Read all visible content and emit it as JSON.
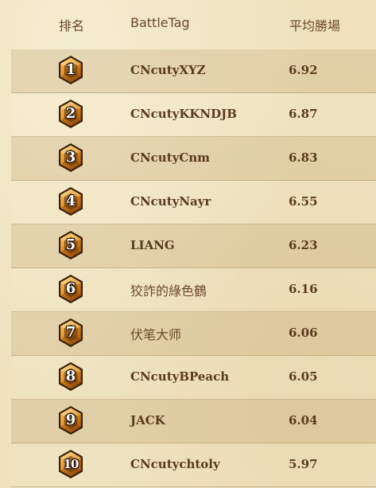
{
  "header": {
    "rank_label": "排名",
    "battletag_label": "BattleTag",
    "avg_label": "平均勝場"
  },
  "colors": {
    "background": "#efe2bd",
    "text": "#5b3a1f",
    "badge_gold": "#e08a1c",
    "badge_dark": "#3a1e0a"
  },
  "rows": [
    {
      "rank": "1",
      "battletag": "CNcutyXYZ",
      "avg": "6.92",
      "icon": "rank-hexagon-icon"
    },
    {
      "rank": "2",
      "battletag": "CNcutyKKNDJB",
      "avg": "6.87",
      "icon": "rank-hexagon-icon"
    },
    {
      "rank": "3",
      "battletag": "CNcutyCnm",
      "avg": "6.83",
      "icon": "rank-hexagon-icon"
    },
    {
      "rank": "4",
      "battletag": "CNcutyNayr",
      "avg": "6.55",
      "icon": "rank-hexagon-icon"
    },
    {
      "rank": "5",
      "battletag": "LIANG",
      "avg": "6.23",
      "icon": "rank-hexagon-icon"
    },
    {
      "rank": "6",
      "battletag": "狡詐的綠色鶴",
      "avg": "6.16",
      "icon": "rank-hexagon-icon"
    },
    {
      "rank": "7",
      "battletag": "伏笔大师",
      "avg": "6.06",
      "icon": "rank-hexagon-icon"
    },
    {
      "rank": "8",
      "battletag": "CNcutyBPeach",
      "avg": "6.05",
      "icon": "rank-hexagon-icon"
    },
    {
      "rank": "9",
      "battletag": "JACK",
      "avg": "6.04",
      "icon": "rank-hexagon-icon"
    },
    {
      "rank": "10",
      "battletag": "CNcutychtoly",
      "avg": "5.97",
      "icon": "rank-hexagon-icon"
    }
  ]
}
